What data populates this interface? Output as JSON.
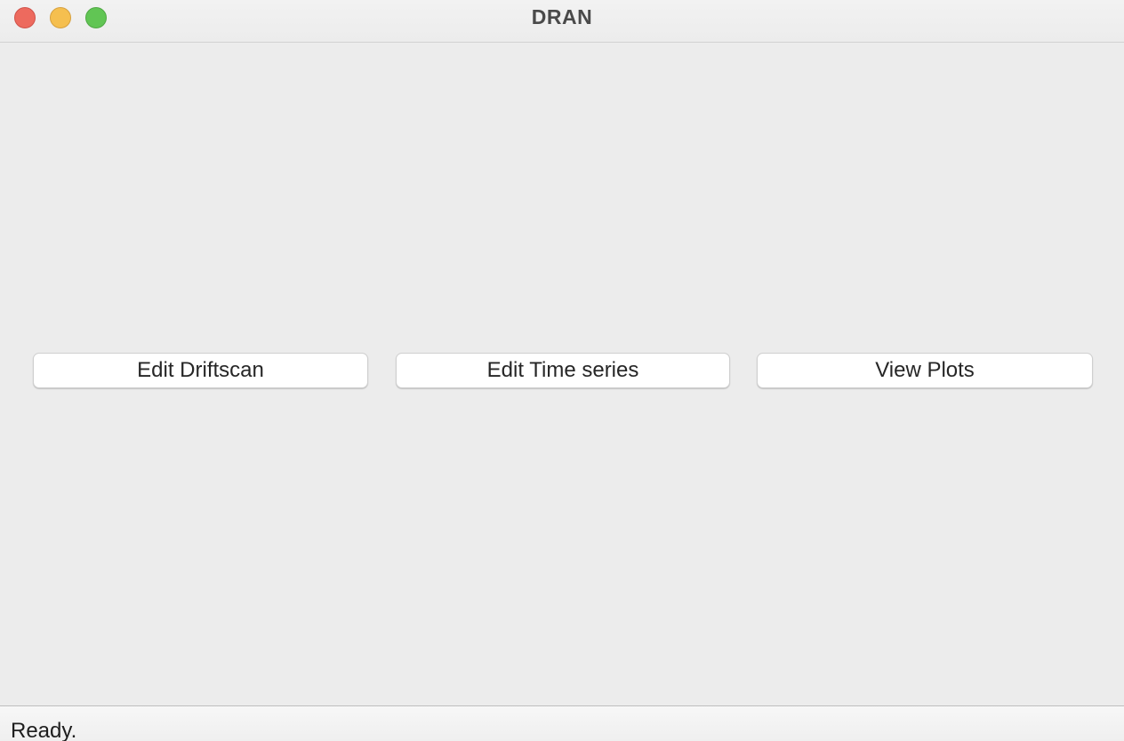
{
  "window": {
    "title": "DRAN"
  },
  "buttons": {
    "edit_driftscan": "Edit Driftscan",
    "edit_time_series": "Edit Time series",
    "view_plots": "View Plots"
  },
  "statusbar": {
    "message": "Ready."
  },
  "colors": {
    "close": "#ed6a5e",
    "minimize": "#f5bf4f",
    "zoom": "#61c554",
    "background": "#ececec"
  }
}
